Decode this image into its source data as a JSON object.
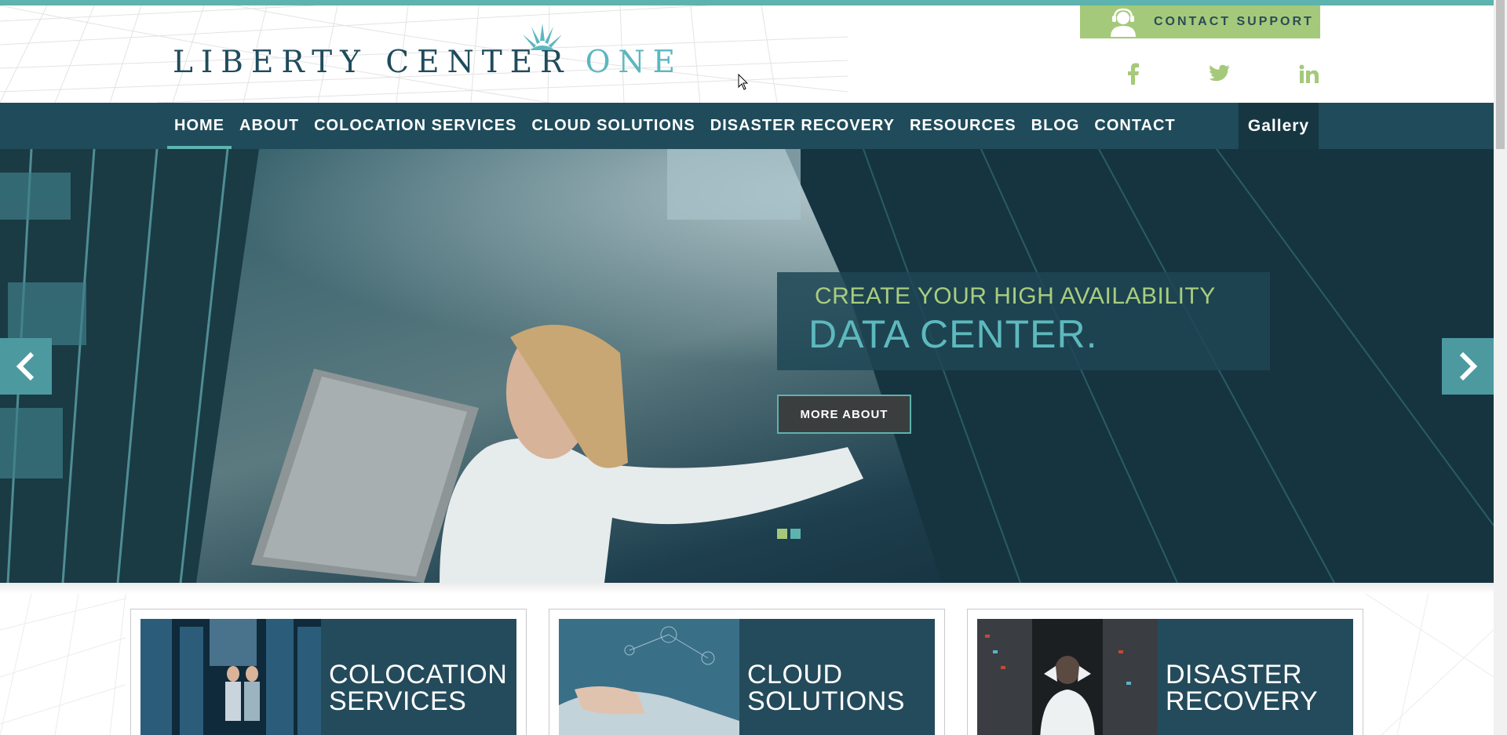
{
  "header": {
    "logo_main": "LIBERTY CENTER",
    "logo_one": "ONE",
    "contact_support": "CONTACT SUPPORT"
  },
  "social": [
    {
      "name": "facebook",
      "glyph": "f"
    },
    {
      "name": "twitter",
      "glyph": "t"
    },
    {
      "name": "linkedin",
      "glyph": "in"
    }
  ],
  "nav": {
    "items": [
      "HOME",
      "ABOUT",
      "COLOCATION SERVICES",
      "CLOUD SOLUTIONS",
      "DISASTER RECOVERY",
      "RESOURCES",
      "BLOG",
      "CONTACT"
    ],
    "active": "HOME",
    "gallery": "Gallery"
  },
  "hero": {
    "line1": "CREATE YOUR HIGH AVAILABILITY",
    "line2": "DATA CENTER.",
    "button": "MORE ABOUT",
    "dot_colors": [
      "#a5c97a",
      "#5db3ad"
    ]
  },
  "cards": [
    {
      "title_line1": "COLOCATION",
      "title_line2": "SERVICES"
    },
    {
      "title_line1": "CLOUD",
      "title_line2": "SOLUTIONS"
    },
    {
      "title_line1": "DISASTER",
      "title_line2": "RECOVERY"
    }
  ],
  "colors": {
    "accent_teal": "#5db3ad",
    "accent_green": "#a5c97a",
    "nav_bg": "#1f4b5a",
    "logo_dark": "#1f4b5c"
  }
}
